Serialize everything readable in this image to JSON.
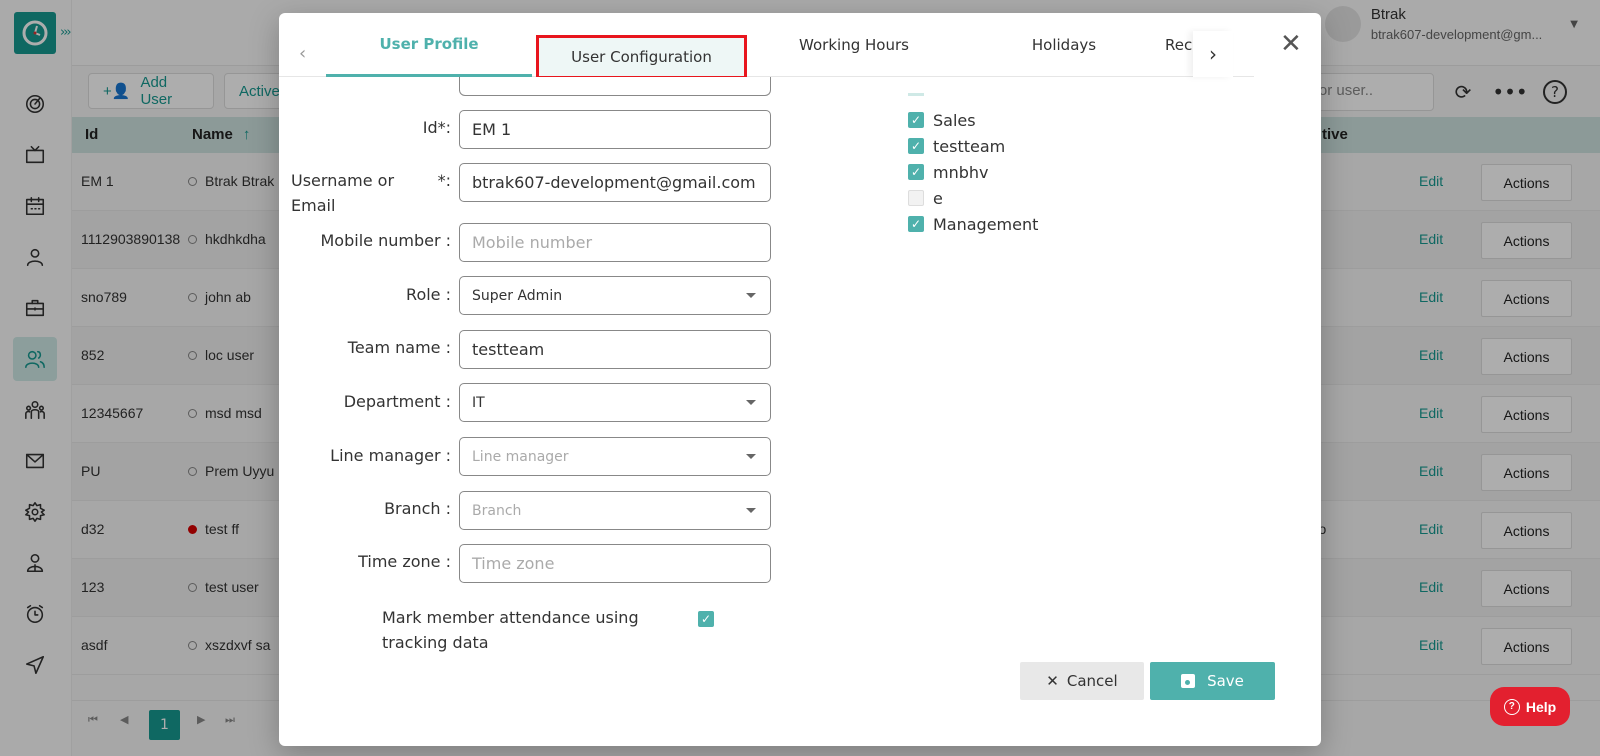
{
  "app": {
    "user": {
      "name": "Btrak",
      "email": "btrak607-development@gm..."
    },
    "toolbar": {
      "add_user_label": "Add User",
      "active_label": "Active"
    },
    "search": {
      "placeholder": "Search for user..",
      "visible_text": "or user.."
    },
    "icons": {
      "refresh": "refresh-icon",
      "more": "more-horizontal-icon",
      "help": "help-circle-icon"
    },
    "sidebar": {
      "items": [
        {
          "name": "dashboard",
          "icon": "target-icon",
          "active": false
        },
        {
          "name": "live",
          "icon": "tv-icon",
          "active": false
        },
        {
          "name": "calendar",
          "icon": "calendar-icon",
          "active": false
        },
        {
          "name": "profile",
          "icon": "user-icon",
          "active": false
        },
        {
          "name": "projects",
          "icon": "briefcase-icon",
          "active": false
        },
        {
          "name": "users",
          "icon": "users-icon",
          "active": true
        },
        {
          "name": "teams",
          "icon": "team-icon",
          "active": false
        },
        {
          "name": "mail",
          "icon": "mail-icon",
          "active": false
        },
        {
          "name": "settings",
          "icon": "gear-icon",
          "active": false
        },
        {
          "name": "employee",
          "icon": "employee-icon",
          "active": false
        },
        {
          "name": "timesheet",
          "icon": "alarm-clock-icon",
          "active": false
        },
        {
          "name": "send",
          "icon": "send-icon",
          "active": false
        }
      ]
    },
    "table": {
      "headers": {
        "id": "Id",
        "name": "Name",
        "active": "tive"
      },
      "rows": [
        {
          "id": "EM 1",
          "name": "Btrak Btrak",
          "status": "offline",
          "active": ""
        },
        {
          "id": "1112903890138",
          "name": "hkdhkdha",
          "status": "offline",
          "active": ""
        },
        {
          "id": "sno789",
          "name": "john ab",
          "status": "offline",
          "active": ""
        },
        {
          "id": "852",
          "name": "loc user",
          "status": "offline",
          "active": ""
        },
        {
          "id": "12345667",
          "name": "msd msd",
          "status": "offline",
          "active": ""
        },
        {
          "id": "PU",
          "name": "Prem Uyyu",
          "status": "offline",
          "active": ""
        },
        {
          "id": "d32",
          "name": "test ff",
          "status": "busy",
          "active": "s ago"
        },
        {
          "id": "123",
          "name": "test user",
          "status": "offline",
          "active": ""
        },
        {
          "id": "asdf",
          "name": "xszdxvf sa",
          "status": "offline",
          "active": ""
        }
      ],
      "edit_label": "Edit",
      "actions_label": "Actions"
    },
    "pager": {
      "current_page": "1"
    },
    "help_label": "Help"
  },
  "modal": {
    "tabs": [
      {
        "label": "User Profile",
        "active": true
      },
      {
        "label": "User Configuration",
        "highlighted": true
      },
      {
        "label": "Working Hours"
      },
      {
        "label": "Holidays"
      },
      {
        "label": "Rec"
      }
    ],
    "form": {
      "id_label": "Id*:",
      "id_value": "EM 1",
      "username_label_line1": "Username or",
      "username_label_line2": "Email",
      "username_required": "*:",
      "username_value": "btrak607-development@gmail.com",
      "mobile_label": "Mobile number :",
      "mobile_placeholder": "Mobile number",
      "role_label": "Role :",
      "role_value": "Super Admin",
      "team_label": "Team name :",
      "team_value": "testteam",
      "department_label": "Department :",
      "department_value": "IT",
      "line_manager_label": "Line manager :",
      "line_manager_placeholder": "Line manager",
      "branch_label": "Branch :",
      "branch_placeholder": "Branch",
      "timezone_label": "Time zone :",
      "timezone_placeholder": "Time zone",
      "attendance_label": "Mark member attendance using tracking data",
      "attendance_checked": true
    },
    "teams": [
      {
        "label": "Sales",
        "checked": true
      },
      {
        "label": "testteam",
        "checked": true
      },
      {
        "label": "mnbhv",
        "checked": true
      },
      {
        "label": "e",
        "checked": false
      },
      {
        "label": "Management",
        "checked": true
      }
    ],
    "cancel_label": "Cancel",
    "save_label": "Save"
  },
  "colors": {
    "brand": "#179a91",
    "accent": "#4fb1ac",
    "highlight_border": "#e8151d",
    "help": "#e3202f",
    "busy": "#d80000"
  }
}
